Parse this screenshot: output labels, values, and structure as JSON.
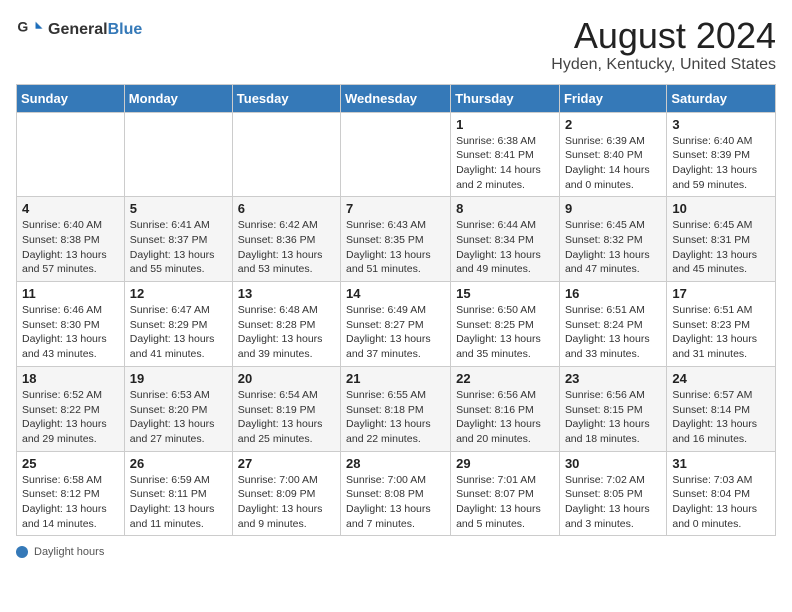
{
  "header": {
    "logo_general": "General",
    "logo_blue": "Blue",
    "title": "August 2024",
    "subtitle": "Hyden, Kentucky, United States"
  },
  "days_of_week": [
    "Sunday",
    "Monday",
    "Tuesday",
    "Wednesday",
    "Thursday",
    "Friday",
    "Saturday"
  ],
  "weeks": [
    [
      {
        "day": "",
        "info": ""
      },
      {
        "day": "",
        "info": ""
      },
      {
        "day": "",
        "info": ""
      },
      {
        "day": "",
        "info": ""
      },
      {
        "day": "1",
        "info": "Sunrise: 6:38 AM\nSunset: 8:41 PM\nDaylight: 14 hours and 2 minutes."
      },
      {
        "day": "2",
        "info": "Sunrise: 6:39 AM\nSunset: 8:40 PM\nDaylight: 14 hours and 0 minutes."
      },
      {
        "day": "3",
        "info": "Sunrise: 6:40 AM\nSunset: 8:39 PM\nDaylight: 13 hours and 59 minutes."
      }
    ],
    [
      {
        "day": "4",
        "info": "Sunrise: 6:40 AM\nSunset: 8:38 PM\nDaylight: 13 hours and 57 minutes."
      },
      {
        "day": "5",
        "info": "Sunrise: 6:41 AM\nSunset: 8:37 PM\nDaylight: 13 hours and 55 minutes."
      },
      {
        "day": "6",
        "info": "Sunrise: 6:42 AM\nSunset: 8:36 PM\nDaylight: 13 hours and 53 minutes."
      },
      {
        "day": "7",
        "info": "Sunrise: 6:43 AM\nSunset: 8:35 PM\nDaylight: 13 hours and 51 minutes."
      },
      {
        "day": "8",
        "info": "Sunrise: 6:44 AM\nSunset: 8:34 PM\nDaylight: 13 hours and 49 minutes."
      },
      {
        "day": "9",
        "info": "Sunrise: 6:45 AM\nSunset: 8:32 PM\nDaylight: 13 hours and 47 minutes."
      },
      {
        "day": "10",
        "info": "Sunrise: 6:45 AM\nSunset: 8:31 PM\nDaylight: 13 hours and 45 minutes."
      }
    ],
    [
      {
        "day": "11",
        "info": "Sunrise: 6:46 AM\nSunset: 8:30 PM\nDaylight: 13 hours and 43 minutes."
      },
      {
        "day": "12",
        "info": "Sunrise: 6:47 AM\nSunset: 8:29 PM\nDaylight: 13 hours and 41 minutes."
      },
      {
        "day": "13",
        "info": "Sunrise: 6:48 AM\nSunset: 8:28 PM\nDaylight: 13 hours and 39 minutes."
      },
      {
        "day": "14",
        "info": "Sunrise: 6:49 AM\nSunset: 8:27 PM\nDaylight: 13 hours and 37 minutes."
      },
      {
        "day": "15",
        "info": "Sunrise: 6:50 AM\nSunset: 8:25 PM\nDaylight: 13 hours and 35 minutes."
      },
      {
        "day": "16",
        "info": "Sunrise: 6:51 AM\nSunset: 8:24 PM\nDaylight: 13 hours and 33 minutes."
      },
      {
        "day": "17",
        "info": "Sunrise: 6:51 AM\nSunset: 8:23 PM\nDaylight: 13 hours and 31 minutes."
      }
    ],
    [
      {
        "day": "18",
        "info": "Sunrise: 6:52 AM\nSunset: 8:22 PM\nDaylight: 13 hours and 29 minutes."
      },
      {
        "day": "19",
        "info": "Sunrise: 6:53 AM\nSunset: 8:20 PM\nDaylight: 13 hours and 27 minutes."
      },
      {
        "day": "20",
        "info": "Sunrise: 6:54 AM\nSunset: 8:19 PM\nDaylight: 13 hours and 25 minutes."
      },
      {
        "day": "21",
        "info": "Sunrise: 6:55 AM\nSunset: 8:18 PM\nDaylight: 13 hours and 22 minutes."
      },
      {
        "day": "22",
        "info": "Sunrise: 6:56 AM\nSunset: 8:16 PM\nDaylight: 13 hours and 20 minutes."
      },
      {
        "day": "23",
        "info": "Sunrise: 6:56 AM\nSunset: 8:15 PM\nDaylight: 13 hours and 18 minutes."
      },
      {
        "day": "24",
        "info": "Sunrise: 6:57 AM\nSunset: 8:14 PM\nDaylight: 13 hours and 16 minutes."
      }
    ],
    [
      {
        "day": "25",
        "info": "Sunrise: 6:58 AM\nSunset: 8:12 PM\nDaylight: 13 hours and 14 minutes."
      },
      {
        "day": "26",
        "info": "Sunrise: 6:59 AM\nSunset: 8:11 PM\nDaylight: 13 hours and 11 minutes."
      },
      {
        "day": "27",
        "info": "Sunrise: 7:00 AM\nSunset: 8:09 PM\nDaylight: 13 hours and 9 minutes."
      },
      {
        "day": "28",
        "info": "Sunrise: 7:00 AM\nSunset: 8:08 PM\nDaylight: 13 hours and 7 minutes."
      },
      {
        "day": "29",
        "info": "Sunrise: 7:01 AM\nSunset: 8:07 PM\nDaylight: 13 hours and 5 minutes."
      },
      {
        "day": "30",
        "info": "Sunrise: 7:02 AM\nSunset: 8:05 PM\nDaylight: 13 hours and 3 minutes."
      },
      {
        "day": "31",
        "info": "Sunrise: 7:03 AM\nSunset: 8:04 PM\nDaylight: 13 hours and 0 minutes."
      }
    ]
  ],
  "footer": {
    "label": "Daylight hours"
  }
}
